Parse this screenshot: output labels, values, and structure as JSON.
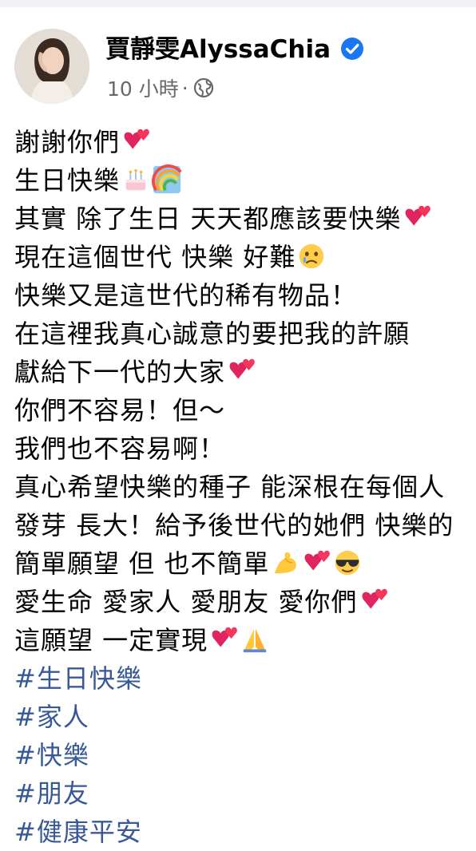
{
  "post": {
    "author": "賈靜雯AlyssaChia",
    "time": "10 小時",
    "dot": "·",
    "lines": [
      "謝謝你們",
      "生日快樂",
      "其實 除了生日 天天都應該要快樂",
      "現在這個世代 快樂 好難",
      "快樂又是這世代的稀有物品！",
      "在這裡我真心誠意的要把我的許願",
      "獻給下一代的大家",
      "你們不容易！但～",
      "我們也不容易啊！",
      "真心希望快樂的種子 能深根在每個人",
      "發芽 長大！給予後世代的她們 快樂的",
      "簡單願望 但 也不簡單",
      "愛生命 愛家人 愛朋友 愛你們",
      "這願望 一定實現"
    ],
    "hashtags": [
      "#生日快樂",
      "#家人",
      "#快樂",
      "#朋友",
      "#健康平安"
    ]
  },
  "colors": {
    "hashtag": "#385898",
    "verified": "#1877f2",
    "meta": "#65676b"
  },
  "icons": {
    "verified": "verified-badge-icon",
    "audience": "globe-icon",
    "hearts": "two-hearts-emoji",
    "cake": "birthday-cake-emoji",
    "rainbow": "rainbow-emoji",
    "crying": "crying-face-emoji",
    "flex": "flexed-biceps-emoji",
    "sunglasses": "sunglasses-face-emoji",
    "pray": "folded-hands-emoji"
  }
}
